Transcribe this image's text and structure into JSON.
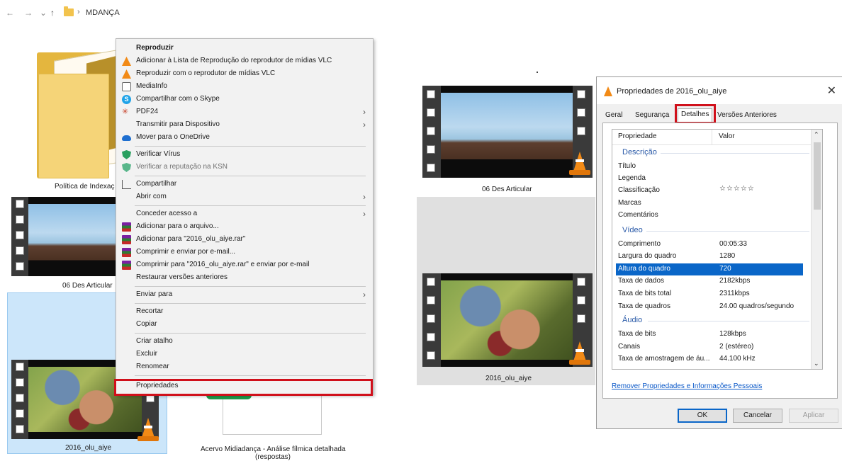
{
  "explorer": {
    "nav": {
      "back": "←",
      "forward": "→",
      "recent": "⌄",
      "up": "↑",
      "sep": "›",
      "path": "MDANÇA"
    },
    "items": {
      "folder_label": "Política de Indexaç",
      "video1_label": "06 Des Articular",
      "video2_label": "2016_olu_aiye",
      "doc_label_line1": "Acervo Midiadança - Análise fílmica detalhada",
      "doc_label_line2": "(respostas)"
    }
  },
  "context_menu": {
    "items": [
      {
        "label": "Reproduzir",
        "bold": true
      },
      {
        "label": "Adicionar à Lista de Reprodução do reprodutor de mídias VLC",
        "icon": "vlc-icon"
      },
      {
        "label": "Reproduzir com o reprodutor de mídias VLC",
        "icon": "vlc-icon"
      },
      {
        "label": "MediaInfo",
        "icon": "mediainfo-icon"
      },
      {
        "label": "Compartilhar com o Skype",
        "icon": "skype-icon"
      },
      {
        "label": "PDF24",
        "icon": "pdf24-icon",
        "submenu": true
      },
      {
        "label": "Transmitir para Dispositivo",
        "submenu": true
      },
      {
        "label": "Mover para o OneDrive",
        "icon": "onedrive-icon"
      },
      {
        "label": "Verificar Vírus",
        "icon": "kaspersky-shield-icon"
      },
      {
        "label": "Verificar a reputação na KSN",
        "icon": "kaspersky-shield-icon",
        "dim": true
      },
      {
        "label": "Compartilhar",
        "icon": "share-icon"
      },
      {
        "label": "Abrir com",
        "submenu": true
      },
      {
        "label": "Conceder acesso a",
        "submenu": true
      },
      {
        "label": "Adicionar para o arquivo...",
        "icon": "winrar-icon"
      },
      {
        "label": "Adicionar para \"2016_olu_aiye.rar\"",
        "icon": "winrar-icon"
      },
      {
        "label": "Comprimir e enviar por e-mail...",
        "icon": "winrar-icon"
      },
      {
        "label": "Comprimir para \"2016_olu_aiye.rar\" e enviar por e-mail",
        "icon": "winrar-icon"
      },
      {
        "label": "Restaurar versões anteriores"
      },
      {
        "label": "Enviar para",
        "submenu": true
      },
      {
        "label": "Recortar"
      },
      {
        "label": "Copiar"
      },
      {
        "label": "Criar atalho"
      },
      {
        "label": "Excluir"
      },
      {
        "label": "Renomear"
      },
      {
        "label": "Propriedades",
        "highlighted": true
      }
    ],
    "submenu_arrow": "›"
  },
  "dialog": {
    "title": "Propriedades de 2016_olu_aiye",
    "close": "✕",
    "tabs": [
      "Geral",
      "Segurança",
      "Detalhes",
      "Versões Anteriores"
    ],
    "active_tab": "Detalhes",
    "columns": {
      "property": "Propriedade",
      "value": "Valor"
    },
    "sections": {
      "description": "Descrição",
      "video": "Vídeo",
      "audio": "Áudio"
    },
    "description_rows": [
      {
        "k": "Título",
        "v": ""
      },
      {
        "k": "Legenda",
        "v": ""
      },
      {
        "k": "Classificação",
        "v": "☆☆☆☆☆"
      },
      {
        "k": "Marcas",
        "v": ""
      },
      {
        "k": "Comentários",
        "v": ""
      }
    ],
    "video_rows": [
      {
        "k": "Comprimento",
        "v": "00:05:33"
      },
      {
        "k": "Largura do quadro",
        "v": "1280"
      },
      {
        "k": "Altura do quadro",
        "v": "720",
        "selected": true
      },
      {
        "k": "Taxa de dados",
        "v": "2182kbps"
      },
      {
        "k": "Taxa de bits total",
        "v": "2311kbps"
      },
      {
        "k": "Taxa de quadros",
        "v": "24.00 quadros/segundo"
      }
    ],
    "audio_rows": [
      {
        "k": "Taxa de bits",
        "v": "128kbps"
      },
      {
        "k": "Canais",
        "v": "2 (estéreo)"
      },
      {
        "k": "Taxa de amostragem de áu...",
        "v": "44.100 kHz"
      }
    ],
    "scroll_up": "⌃",
    "scroll_down": "⌄",
    "remove_link": "Remover Propriedades e Informações Pessoais",
    "buttons": {
      "ok": "OK",
      "cancel": "Cancelar",
      "apply": "Aplicar"
    }
  },
  "colors": {
    "highlight_red": "#d0101b",
    "selection_blue": "#0a66c8",
    "explorer_select": "#cce6fa"
  }
}
